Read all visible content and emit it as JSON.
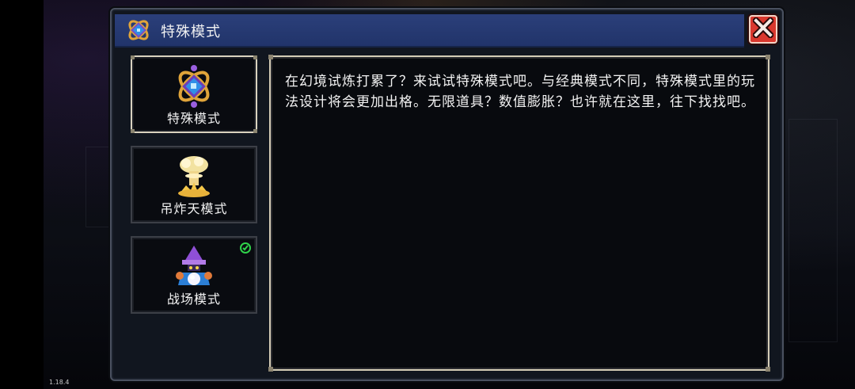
{
  "version": "1.18.4",
  "window": {
    "title": "特殊模式",
    "title_icon": "special-mode-emblem-icon",
    "close_icon": "close-x-icon"
  },
  "modes": [
    {
      "label": "特殊模式",
      "icon": "special-mode-emblem-icon",
      "selected": true,
      "completed": false
    },
    {
      "label": "吊炸天模式",
      "icon": "mushroom-cloud-icon",
      "selected": false,
      "completed": false
    },
    {
      "label": "战场模式",
      "icon": "wizard-crystal-ball-icon",
      "selected": false,
      "completed": true
    }
  ],
  "description": "在幻境试炼打累了？来试试特殊模式吧。与经典模式不同，特殊模式里的玩法设计将会更加出格。无限道具？数值膨胀？也许就在这里，往下找找吧。",
  "colors": {
    "titlebar": "#2b3f7a",
    "close_button": "#d9382e",
    "selected_border": "#d9d2bf",
    "completed_check": "#2fd34a"
  }
}
